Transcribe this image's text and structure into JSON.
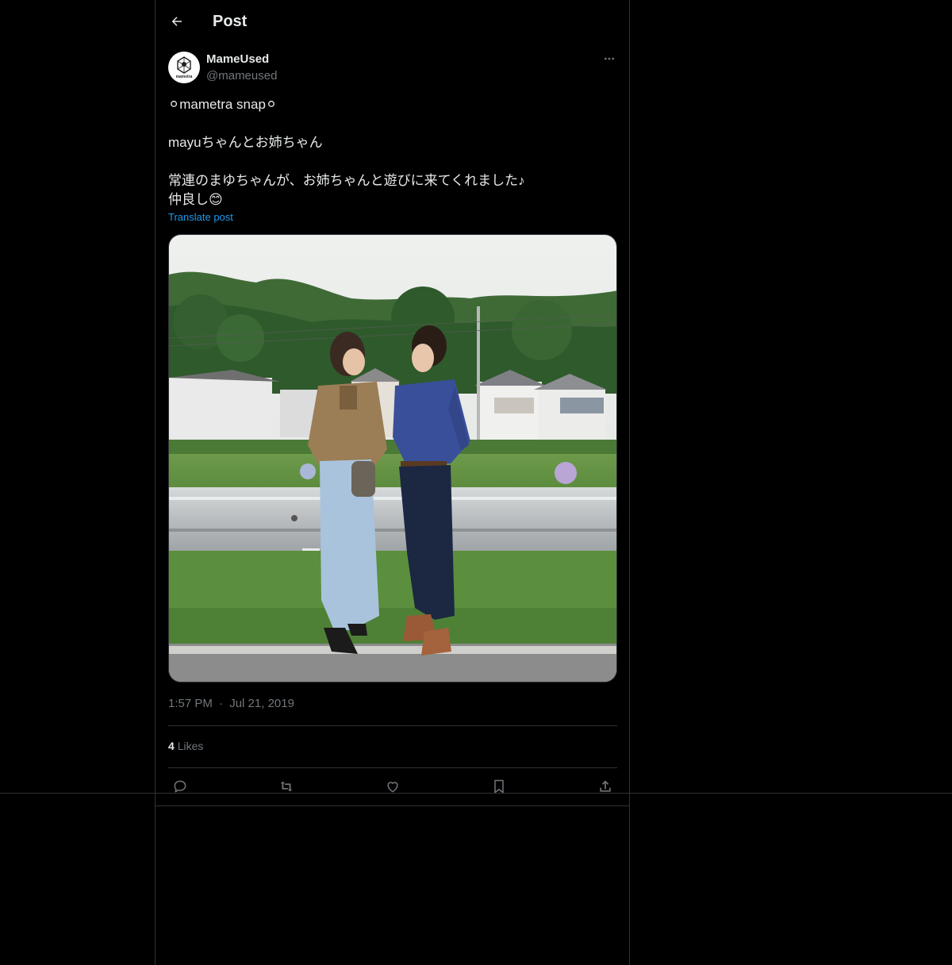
{
  "header": {
    "title": "Post",
    "back_icon": "arrow-left-icon"
  },
  "author": {
    "display_name": "MameUsed",
    "handle": "@mameused",
    "avatar_text": "mametra"
  },
  "post": {
    "lines": [
      "⚪mametra snap⚪",
      "",
      "mayuちゃんとお姉ちゃん",
      "",
      "常連のまゆちゃんが、お姉ちゃんと遊びに来てくれました♪",
      "仲良し😊"
    ],
    "translate_label": "Translate post",
    "photo_description": "two-women-standing-by-guardrail-photo"
  },
  "meta": {
    "time": "1:57 PM",
    "separator": "·",
    "date": "Jul 21, 2019"
  },
  "stats": {
    "likes_count": "4",
    "likes_label": "Likes"
  },
  "actions": [
    {
      "name": "reply",
      "icon": "reply-icon"
    },
    {
      "name": "repost",
      "icon": "repost-icon"
    },
    {
      "name": "like",
      "icon": "heart-icon"
    },
    {
      "name": "bookmark",
      "icon": "bookmark-icon"
    },
    {
      "name": "share",
      "icon": "share-icon"
    }
  ],
  "colors": {
    "background": "#000000",
    "text": "#e7e9ea",
    "muted": "#71767b",
    "link": "#1d9bf0",
    "border": "#2f3336"
  }
}
